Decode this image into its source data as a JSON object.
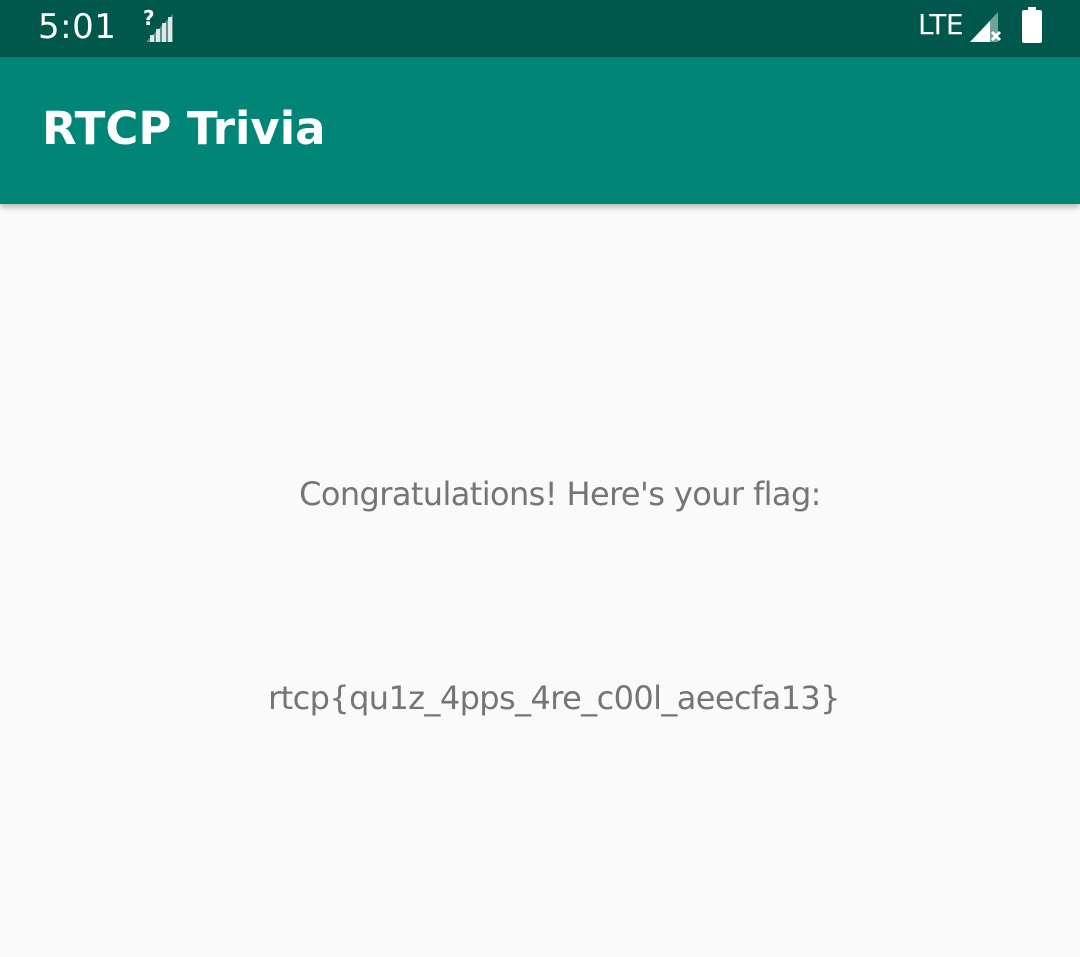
{
  "status_bar": {
    "time": "5:01",
    "network_type": "LTE",
    "icons": [
      "wifi-signal-unknown-icon",
      "cell-signal-no-data-icon",
      "battery-full-icon"
    ]
  },
  "app_bar": {
    "title": "RTCP Trivia"
  },
  "main": {
    "message": "Congratulations! Here's your flag:",
    "flag": "rtcp{qu1z_4pps_4re_c00l_aeecfa13}"
  },
  "colors": {
    "status_bar": "#00574b",
    "app_bar": "#008577",
    "background": "#fafafa",
    "body_text": "#757575"
  }
}
